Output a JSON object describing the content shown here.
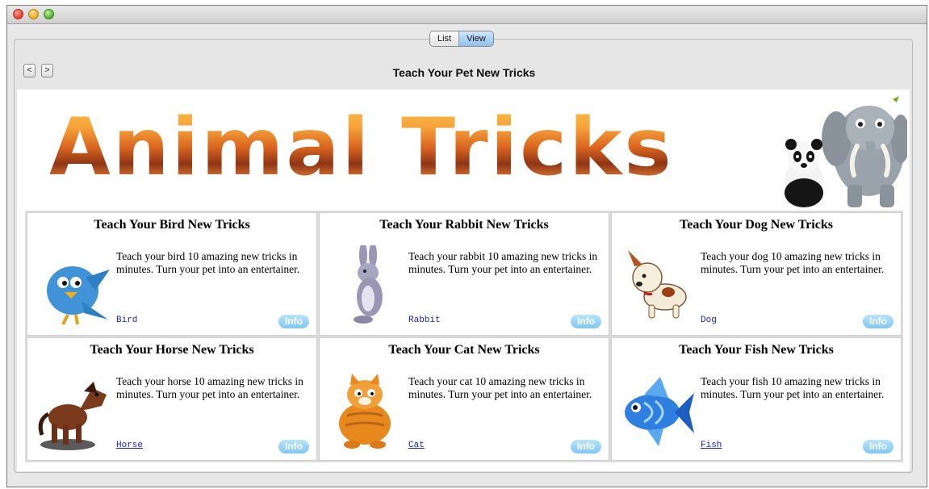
{
  "window": {
    "segmented": {
      "list_label": "List",
      "view_label": "View"
    },
    "nav": {
      "back_label": "<",
      "forward_label": ">"
    },
    "page_title": "Teach Your Pet New Tricks"
  },
  "banner": {
    "title": "Animal Tricks"
  },
  "cards": [
    {
      "heading": "Teach Your Bird New Tricks",
      "description": "Teach your bird 10 amazing new tricks in minutes. Turn your pet into an entertainer.",
      "link": "Bird",
      "info": "Info",
      "icon": "bird-icon"
    },
    {
      "heading": "Teach Your Rabbit New Tricks",
      "description": "Teach your rabbit 10 amazing new tricks in minutes. Turn your pet into an entertainer.",
      "link": "Rabbit",
      "info": "Info",
      "icon": "rabbit-icon"
    },
    {
      "heading": "Teach Your Dog New Tricks",
      "description": "Teach your dog 10 amazing new tricks in minutes. Turn your pet into an entertainer.",
      "link": "Dog",
      "info": "Info",
      "icon": "dog-icon"
    },
    {
      "heading": "Teach Your Horse New Tricks",
      "description": "Teach your horse 10 amazing new tricks in minutes. Turn your pet into an entertainer.",
      "link": "Horse",
      "info": "Info",
      "icon": "horse-icon"
    },
    {
      "heading": "Teach Your Cat New Tricks",
      "description": "Teach your cat 10 amazing new tricks in minutes. Turn your pet into an entertainer.",
      "link": "Cat",
      "info": "Info",
      "icon": "cat-icon"
    },
    {
      "heading": "Teach Your Fish New Tricks",
      "description": "Teach your fish 10 amazing new tricks in minutes. Turn your pet into an entertainer.",
      "link": "Fish",
      "info": "Info",
      "icon": "fish-icon"
    }
  ],
  "colors": {
    "info_button": "#8fcdf3",
    "link": "#1a1ad0",
    "segment_selected": "#9cc8f0"
  }
}
